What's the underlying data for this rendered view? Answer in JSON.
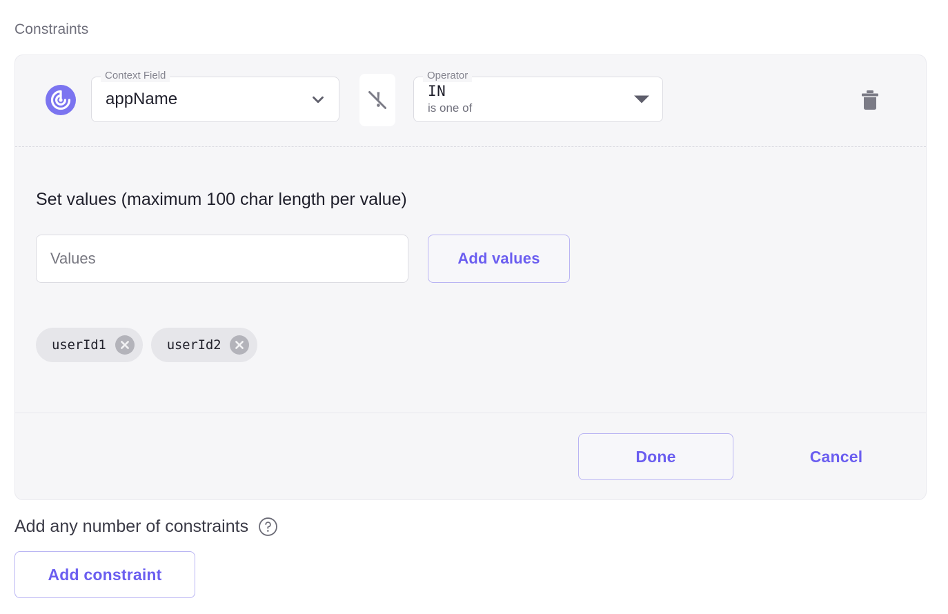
{
  "section": {
    "title": "Constraints"
  },
  "constraint": {
    "icon": "target-icon",
    "context_field": {
      "legend": "Context Field",
      "value": "appName",
      "chevron": "chevron-down-icon"
    },
    "negate_toggle": {
      "icon": "exclamation-slash-icon",
      "state": "off"
    },
    "operator": {
      "legend": "Operator",
      "value": "IN",
      "description": "is one of",
      "chevron": "triangle-down-icon"
    },
    "delete": {
      "icon": "trash-icon"
    },
    "values_section": {
      "title": "Set values (maximum 100 char length per value)",
      "input_placeholder": "Values",
      "input_value": "",
      "add_button_label": "Add values",
      "chips": [
        {
          "label": "userId1",
          "remove_icon": "close-circle-icon"
        },
        {
          "label": "userId2",
          "remove_icon": "close-circle-icon"
        }
      ]
    },
    "footer": {
      "done_label": "Done",
      "cancel_label": "Cancel"
    }
  },
  "bottom": {
    "helper_text": "Add any number of constraints",
    "help_icon": "question-circle-icon",
    "add_constraint_label": "Add constraint"
  },
  "colors": {
    "accent": "#6b5ef0",
    "accent_border": "#b9b4f3",
    "card_bg": "#f6f6f8",
    "card_border": "#eaeaef",
    "field_border": "#dcdce2",
    "text_primary": "#1f1f2b",
    "text_muted": "#84848f",
    "chip_bg": "#e6e6ea",
    "chip_close_bg": "#b3b3ba",
    "icon_gray": "#7b7b86"
  }
}
